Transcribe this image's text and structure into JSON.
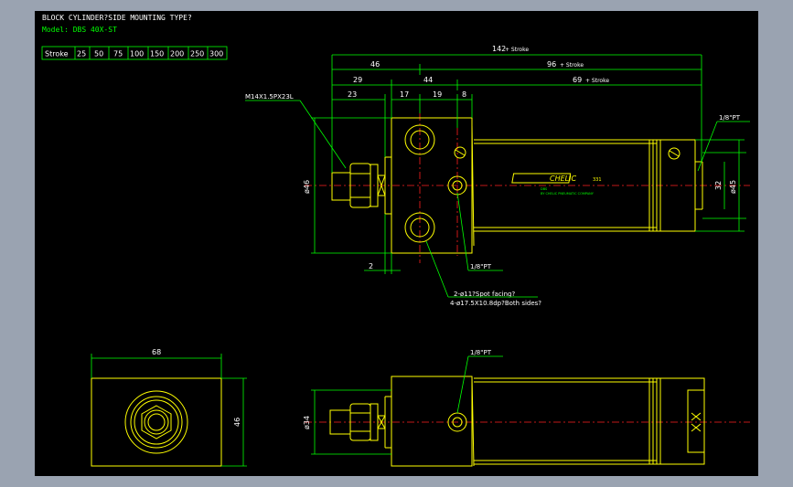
{
  "title": "BLOCK CYLINDER?SIDE MOUNTING TYPE?",
  "model": "Model: DBS 40X-ST",
  "stroke_table": {
    "header": "Stroke",
    "values": [
      "25",
      "50",
      "75",
      "100",
      "150",
      "200",
      "250",
      "300"
    ]
  },
  "dimensions": {
    "d142": "142",
    "d142_suffix": "+ Stroke",
    "d96": "96",
    "d96_suffix": "+ Stroke",
    "d46": "46",
    "d44": "44",
    "d69": "69",
    "d69_suffix": "+ Stroke",
    "d29": "29",
    "d23": "23",
    "d17": "17",
    "d19": "19",
    "d8": "8",
    "d2": "2",
    "phi46": "ø46",
    "phi45": "ø45",
    "d32": "32",
    "d68": "68",
    "d46_side": "46",
    "phi34": "ø34"
  },
  "callouts": {
    "thread": "M14X1.5PX23L",
    "port_top": "1/8\"PT",
    "port_mid": "1/8\"PT",
    "port_bottom": "1/8\"PT",
    "holes1": "2-ø11?Spot facing?",
    "holes2": "4-ø17.5X10.8dp?Both sides?",
    "brand": "CHELIC",
    "brand_num": "331",
    "plate_line1": "DBS",
    "plate_line2": "BY CHELIC PNEUMATIC COMPANY"
  },
  "colors": {
    "frame": "#9aa3b1",
    "background": "#000000",
    "outline": "#ffff00",
    "dimension": "#00ff00",
    "centerline": "#ff2020",
    "text": "#ffffff"
  }
}
